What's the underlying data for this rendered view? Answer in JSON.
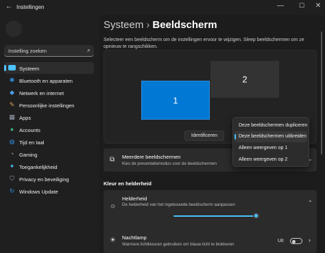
{
  "window": {
    "title": "Instellingen",
    "back_icon": "arrow-left-icon",
    "controls": [
      "minimize-icon",
      "maximize-icon",
      "close-icon"
    ]
  },
  "sidebar": {
    "search_placeholder": "Instelling zoeken",
    "items": [
      {
        "label": "Systeem",
        "icon": "monitor-icon",
        "color": "#4cc2ff",
        "active": true
      },
      {
        "label": "Bluetooth en apparaten",
        "icon": "bluetooth-icon",
        "color": "#2f8fe0"
      },
      {
        "label": "Netwerk en internet",
        "icon": "network-icon",
        "color": "#4aa0e6"
      },
      {
        "label": "Persoonlijke instellingen",
        "icon": "brush-icon",
        "color": "#e6a15a"
      },
      {
        "label": "Apps",
        "icon": "apps-icon",
        "color": "#9aa4b2"
      },
      {
        "label": "Accounts",
        "icon": "person-icon",
        "color": "#3fb27f"
      },
      {
        "label": "Tijd en taal",
        "icon": "globe-clock-icon",
        "color": "#2f8fe0"
      },
      {
        "label": "Gaming",
        "icon": "controller-icon",
        "color": "#9aa4b2"
      },
      {
        "label": "Toegankelijkheid",
        "icon": "accessibility-icon",
        "color": "#4cc2ff"
      },
      {
        "label": "Privacy en beveiliging",
        "icon": "shield-icon",
        "color": "#9aa4b2"
      },
      {
        "label": "Windows Update",
        "icon": "update-icon",
        "color": "#2f8fe0"
      }
    ]
  },
  "header": {
    "parent": "Systeem",
    "separator": "›",
    "title": "Beeldscherm",
    "description": "Selecteer een beeldscherm om de instellingen ervoor te wijzigen. Sleep beeldschermen om ze opnieuw te rangschikken."
  },
  "arrangement": {
    "monitor_1": "1",
    "monitor_2": "2",
    "identify_label": "Identificeren"
  },
  "multi_display": {
    "title": "Meerdere beeldschermen",
    "subtitle": "Kies de presentatiemodus voor de beeldschermen",
    "icon": "multi-display-icon",
    "chevron_icon": "chevron-down-icon"
  },
  "dropdown": {
    "options": [
      "Deze beeldschermen dupliceren",
      "Deze beeldschermen uitbreiden",
      "Alleen weergeven op 1",
      "Alleen weergeven op 2"
    ],
    "selected_index": 1
  },
  "section_title": "Kleur en helderheid",
  "brightness": {
    "title": "Helderheid",
    "subtitle": "De helderheid van het ingebouwde beeldscherm aanpassen",
    "icon": "sun-icon",
    "chevron_icon": "chevron-up-icon",
    "value": 1.0
  },
  "nightlight": {
    "title": "Nachtlamp",
    "subtitle": "Warmere lichtkleuren gebruiken om blauw licht te blokkeren",
    "icon": "sun-dim-icon",
    "state_label": "Uit",
    "on": false,
    "chevron_icon": "chevron-right-icon"
  },
  "accent_color": "#4cc2ff"
}
